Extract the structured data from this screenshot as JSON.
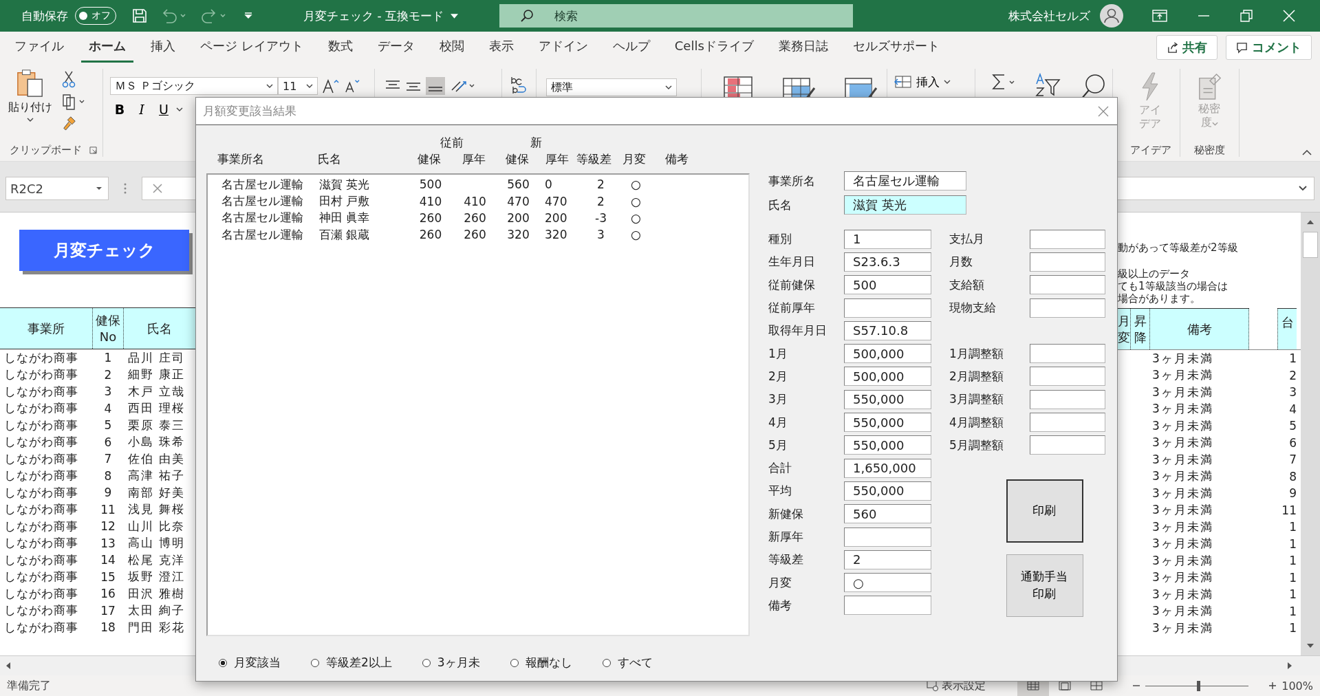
{
  "title_bar": {
    "autosave_label": "自動保存",
    "autosave_toggle": {
      "label": "オフ",
      "on": false
    },
    "title": "月変チェック - 互換モード",
    "search_placeholder": "検索",
    "account": "株式会社セルズ"
  },
  "ribbon_tabs": [
    {
      "label": "ファイル",
      "selected": false
    },
    {
      "label": "ホーム",
      "selected": true
    },
    {
      "label": "挿入",
      "selected": false
    },
    {
      "label": "ページ レイアウト",
      "selected": false
    },
    {
      "label": "数式",
      "selected": false
    },
    {
      "label": "データ",
      "selected": false
    },
    {
      "label": "校閲",
      "selected": false
    },
    {
      "label": "表示",
      "selected": false
    },
    {
      "label": "アドイン",
      "selected": false
    },
    {
      "label": "ヘルプ",
      "selected": false
    },
    {
      "label": "Cellsドライブ",
      "selected": false
    },
    {
      "label": "業務日誌",
      "selected": false
    },
    {
      "label": "セルズサポート",
      "selected": false
    }
  ],
  "share_button": "共有",
  "comment_button": "コメント",
  "ribbon": {
    "paste": "貼り付け",
    "clipboard_group": "クリップボード",
    "font_name": "ＭＳ Ｐゴシック",
    "font_size": "11",
    "bold": "B",
    "italic": "I",
    "underline": "U",
    "number_format": "標準",
    "insert": "挿入",
    "ideas": "アイデア",
    "sensitivity": "秘密度",
    "ideas_group": "アイデア",
    "sensitivity_group": "秘密度"
  },
  "formula_bar": {
    "name_box": "R2C2"
  },
  "sheet": {
    "macro_button": "月変チェック",
    "left_columns": [
      "事業所",
      "健保No",
      "氏名"
    ],
    "left_rows": [
      [
        "しながわ商事",
        "1",
        "品川 庄司"
      ],
      [
        "しながわ商事",
        "2",
        "細野 康正"
      ],
      [
        "しながわ商事",
        "3",
        "木戸 立哉"
      ],
      [
        "しながわ商事",
        "4",
        "西田 理桜"
      ],
      [
        "しながわ商事",
        "5",
        "栗原 泰三"
      ],
      [
        "しながわ商事",
        "6",
        "小島 珠希"
      ],
      [
        "しながわ商事",
        "7",
        "佐伯 由美"
      ],
      [
        "しながわ商事",
        "8",
        "高津 祐子"
      ],
      [
        "しながわ商事",
        "9",
        "南部 好美"
      ],
      [
        "しながわ商事",
        "11",
        "浅見 舞桜"
      ],
      [
        "しながわ商事",
        "12",
        "山川 比奈"
      ],
      [
        "しながわ商事",
        "13",
        "高山 博明"
      ],
      [
        "しながわ商事",
        "14",
        "松尾 克洋"
      ],
      [
        "しながわ商事",
        "15",
        "坂野 澄江"
      ],
      [
        "しながわ商事",
        "16",
        "田沢 雅樹"
      ],
      [
        "しながわ商事",
        "17",
        "太田 絢子"
      ],
      [
        "しながわ商事",
        "18",
        "門田 彩花"
      ]
    ],
    "notes": [
      "動があって等級差が2等級",
      "級以上のデータ",
      "ても1等級該当の場合は",
      "場合があります。"
    ],
    "right_columns": [
      "月変",
      "昇降",
      "備考",
      "台"
    ],
    "right_rows": [
      [
        "3ヶ月未満",
        "1"
      ],
      [
        "3ヶ月未満",
        "2"
      ],
      [
        "3ヶ月未満",
        "3"
      ],
      [
        "3ヶ月未満",
        "4"
      ],
      [
        "3ヶ月未満",
        "5"
      ],
      [
        "3ヶ月未満",
        "6"
      ],
      [
        "3ヶ月未満",
        "7"
      ],
      [
        "3ヶ月未満",
        "8"
      ],
      [
        "3ヶ月未満",
        "9"
      ],
      [
        "3ヶ月未満",
        "11"
      ],
      [
        "3ヶ月未満",
        "1"
      ],
      [
        "3ヶ月未満",
        "1"
      ],
      [
        "3ヶ月未満",
        "1"
      ],
      [
        "3ヶ月未満",
        "1"
      ],
      [
        "3ヶ月未満",
        "1"
      ],
      [
        "3ヶ月未満",
        "1"
      ],
      [
        "3ヶ月未満",
        "1"
      ]
    ]
  },
  "dialog": {
    "title": "月額変更該当結果",
    "group_headers": [
      "従前",
      "新"
    ],
    "columns": [
      "事業所名",
      "氏名",
      "健保",
      "厚年",
      "健保",
      "厚年",
      "等級差",
      "月変",
      "備考"
    ],
    "rows": [
      {
        "office": "名古屋セル運輸",
        "name": "滋賀 英光",
        "old_health": "500",
        "new_health": "560",
        "new_pension": "0",
        "grade_diff": "2",
        "change": "○"
      },
      {
        "office": "名古屋セル運輸",
        "name": "田村 戸敷",
        "old_health": "410",
        "old_pension": "410",
        "new_health": "470",
        "new_pension": "470",
        "grade_diff": "2",
        "change": "○"
      },
      {
        "office": "名古屋セル運輸",
        "name": "神田 眞幸",
        "old_health": "260",
        "old_pension": "260",
        "new_health": "200",
        "new_pension": "200",
        "grade_diff": "-3",
        "change": "○"
      },
      {
        "office": "名古屋セル運輸",
        "name": "百瀬 銀蔵",
        "old_health": "260",
        "old_pension": "260",
        "new_health": "320",
        "new_pension": "320",
        "grade_diff": "3",
        "change": "○"
      }
    ],
    "office_field": {
      "label": "事業所名",
      "value": "名古屋セル運輸",
      "highlighted": false
    },
    "name_field": {
      "label": "氏名",
      "value": "滋賀 英光",
      "highlighted": true
    },
    "fields": [
      {
        "label": "種別",
        "value": "1"
      },
      {
        "label": "生年月日",
        "value": "S23.6.3"
      },
      {
        "label": "従前健保",
        "value": "500"
      },
      {
        "label": "従前厚年"
      },
      {
        "label": "取得年月日",
        "value": "S57.10.8"
      },
      {
        "label": "1月",
        "value": "500,000"
      },
      {
        "label": "2月",
        "value": "500,000"
      },
      {
        "label": "3月",
        "value": "550,000"
      },
      {
        "label": "4月",
        "value": "550,000"
      },
      {
        "label": "5月",
        "value": "550,000"
      },
      {
        "label": "合計",
        "value": "1,650,000"
      },
      {
        "label": "平均",
        "value": "550,000"
      },
      {
        "label": "新健保",
        "value": "560"
      },
      {
        "label": "新厚年"
      },
      {
        "label": "等級差",
        "value": "2"
      },
      {
        "label": "月変",
        "value": "○"
      },
      {
        "label": "備考"
      }
    ],
    "payment_fields": [
      {
        "label": "支払月"
      },
      {
        "label": "月数"
      },
      {
        "label": "支給額"
      },
      {
        "label": "現物支給"
      }
    ],
    "adjustment_fields": [
      {
        "label": "1月調整額"
      },
      {
        "label": "2月調整額"
      },
      {
        "label": "3月調整額"
      },
      {
        "label": "4月調整額"
      },
      {
        "label": "5月調整額"
      }
    ],
    "buttons": [
      {
        "label": "印刷",
        "default": true
      },
      {
        "label": "通勤手当印刷",
        "default": false
      }
    ],
    "filters": [
      {
        "label": "月変該当",
        "selected": true
      },
      {
        "label": "等級差2以上",
        "selected": false
      },
      {
        "label": "3ヶ月未",
        "selected": false
      },
      {
        "label": "報酬なし",
        "selected": false
      },
      {
        "label": "すべて",
        "selected": false
      }
    ]
  },
  "status_bar": {
    "status": "準備完了",
    "display_settings": "表示設定",
    "views": [
      {
        "selected": true
      },
      {
        "selected": false
      },
      {
        "selected": false
      }
    ],
    "zoom": {
      "level": 0.5
    },
    "zoom_value": "100%"
  }
}
